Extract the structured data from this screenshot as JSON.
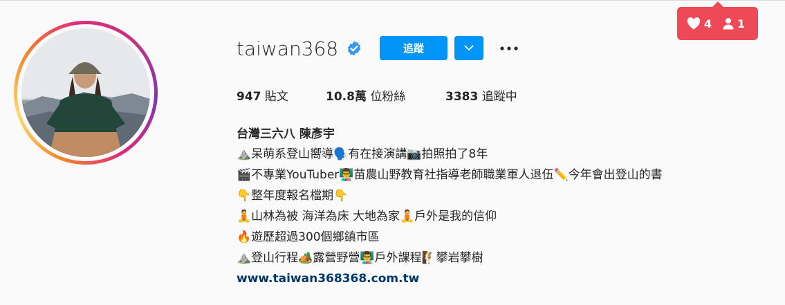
{
  "profile": {
    "username": "taiwan368",
    "follow_label": "追蹤",
    "more_label": "•••"
  },
  "stats": [
    {
      "count": "947",
      "label": "貼文"
    },
    {
      "count": "10.8萬",
      "label": "位粉絲"
    },
    {
      "count": "3383",
      "label": "追蹤中"
    }
  ],
  "bio": {
    "name": "台灣三六八 陳彥宇",
    "lines": [
      "⛰️呆萌系登山嚮導🗣️有在接演講📷拍照拍了8年",
      "🎬不專業YouTuber👨‍🏫苗農山野教育社指導老師職業軍人退伍✏️今年會出登山的書",
      "👇整年度報名檔期👇",
      "🧘山林為被 海洋為床 大地為家🧘戶外是我的信仰",
      "🔥遊歷超過300個鄉鎮市區",
      "⛰️登山行程🏕️露營野營👨‍🏫戶外課程🧗攀岩攀樹"
    ],
    "link": "www.taiwan368368.com.tw"
  },
  "notification": {
    "likes": "4",
    "follows": "1"
  },
  "colors": {
    "accent": "#0095f6",
    "link": "#00376b",
    "notification": "#ed4956"
  },
  "icons": {
    "verified": "verified-badge-icon",
    "dropdown": "chevron-down-icon",
    "more": "more-options-icon",
    "heart": "heart-icon",
    "person": "person-icon"
  }
}
